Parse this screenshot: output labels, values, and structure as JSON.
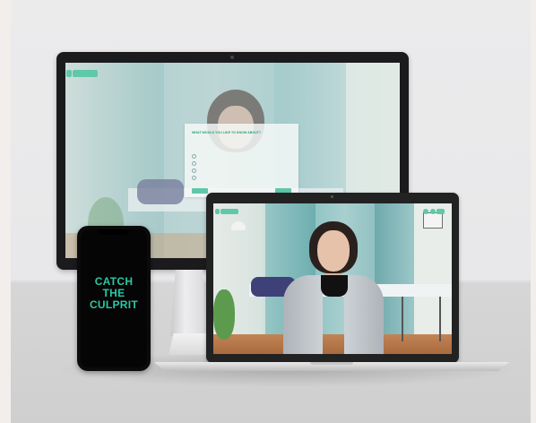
{
  "monitor_screen": {
    "dialog": {
      "title": "WHAT WOULD YOU LIKE TO KNOW ABOUT?",
      "options": [
        "",
        "",
        "",
        ""
      ]
    },
    "colors": {
      "accent": "#5fc8a8"
    }
  },
  "laptop_screen": {
    "colors": {
      "accent": "#5fc8a8"
    }
  },
  "phone_screen": {
    "title_lines": [
      "CATCH",
      "THE",
      "CULPRIT"
    ],
    "colors": {
      "title": "#29c8a6",
      "background": "#050505"
    }
  }
}
